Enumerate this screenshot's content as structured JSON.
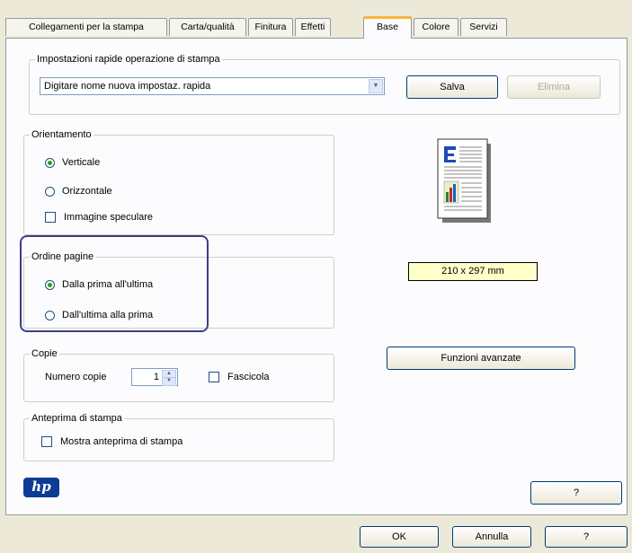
{
  "tabs": [
    {
      "label": "Collegamenti per la stampa",
      "active": false
    },
    {
      "label": "Carta/qualità",
      "active": false
    },
    {
      "label": "Finitura",
      "active": false
    },
    {
      "label": "Effetti",
      "active": false
    },
    {
      "label": "Base",
      "active": true
    },
    {
      "label": "Colore",
      "active": false
    },
    {
      "label": "Servizi",
      "active": false
    }
  ],
  "quick_settings": {
    "legend": "Impostazioni rapide operazione di stampa",
    "combo_value": "Digitare nome nuova impostaz. rapida",
    "save_label": "Salva",
    "delete_label": "Elimina"
  },
  "orientation": {
    "legend": "Orientamento",
    "portrait_label": "Verticale",
    "portrait_selected": true,
    "landscape_label": "Orizzontale",
    "mirror_label": "Immagine speculare",
    "mirror_checked": false
  },
  "page_order": {
    "legend": "Ordine pagine",
    "first_to_last_label": "Dalla prima all'ultima",
    "first_to_last_selected": true,
    "last_to_first_label": "Dall'ultima alla prima"
  },
  "copies": {
    "legend": "Copie",
    "count_label": "Numero copie",
    "count_value": "1",
    "collate_label": "Fascicola",
    "collate_checked": false
  },
  "preview": {
    "legend": "Anteprima di stampa",
    "show_label": "Mostra anteprima di stampa",
    "show_checked": false
  },
  "paper_size": "210 x 297 mm",
  "advanced_label": "Funzioni avanzate",
  "help_label": "?",
  "dialog_buttons": {
    "ok": "OK",
    "cancel": "Annulla",
    "help": "?"
  },
  "logo_text": "hp",
  "colors": {
    "highlight": "#3a3f84",
    "active_tab_accent": "#f9b43c",
    "paper_size_bg": "#ffffc8",
    "hp_blue": "#0e3b96"
  },
  "icons": {
    "document_preview": "document-preview-icon",
    "logo": "hp-logo-icon"
  }
}
